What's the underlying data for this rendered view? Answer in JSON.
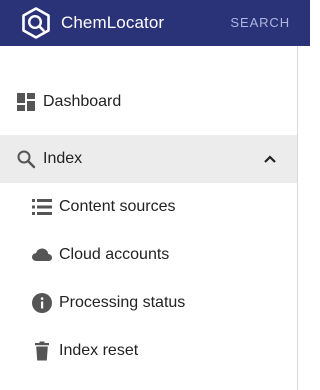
{
  "header": {
    "app_name": "ChemLocator",
    "search_label": "SEARCH",
    "logo_icon": "chemlocator-logo-icon",
    "background_color": "#2b3378"
  },
  "sidebar": {
    "items": [
      {
        "label": "Dashboard",
        "icon": "dashboard-icon"
      },
      {
        "label": "Index",
        "icon": "search-icon",
        "expanded": true
      }
    ],
    "index_children": [
      {
        "label": "Content sources",
        "icon": "list-icon"
      },
      {
        "label": "Cloud accounts",
        "icon": "cloud-icon"
      },
      {
        "label": "Processing status",
        "icon": "info-icon"
      },
      {
        "label": "Index reset",
        "icon": "trash-icon"
      }
    ]
  }
}
